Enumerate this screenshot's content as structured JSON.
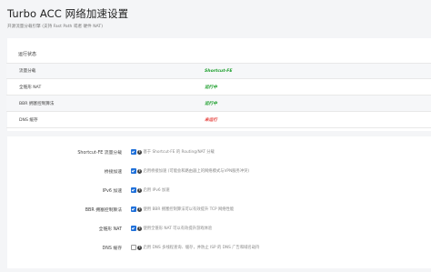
{
  "page": {
    "title": "Turbo ACC 网络加速设置",
    "description": "开源流量分载引擎 (支持 Fast Path 或者 硬件 NAT)"
  },
  "status": {
    "title": "运行状态",
    "rows": [
      {
        "label": "流量分载",
        "value": "Shortcut-FE",
        "color": "#1a9e2a"
      },
      {
        "label": "全锥形 NAT",
        "value": "运行中",
        "color": "#1a9e2a"
      },
      {
        "label": "BBR 拥塞控制算法",
        "value": "运行中",
        "color": "#1a9e2a"
      },
      {
        "label": "DNS 缓存",
        "value": "未运行",
        "color": "#e53935"
      }
    ]
  },
  "settings": {
    "rows": [
      {
        "label": "Shortcut-FE 流量分载",
        "checked": true,
        "hint": "基于 Shortcut-FE 的 Routing/NAT 分载"
      },
      {
        "label": "桥接加速",
        "checked": true,
        "hint": "启用桥接加速 (可能会和路由器上的网络模式与VPN服务冲突)"
      },
      {
        "label": "IPv6 加速",
        "checked": true,
        "hint": "启用 IPv6 加速"
      },
      {
        "label": "BBR 拥塞控制算法",
        "checked": true,
        "hint": "使用 BBR 拥塞控制算法可以有效提升 TCP 网络性能"
      },
      {
        "label": "全锥形 NAT",
        "checked": true,
        "hint": "使用全锥形 NAT 可以有效提升游戏体验"
      },
      {
        "label": "DNS 缓存",
        "checked": false,
        "hint": "启用 DNS 多线程查询、缓存，并防止 ISP 的 DNS 广告和域名劫持"
      }
    ]
  }
}
